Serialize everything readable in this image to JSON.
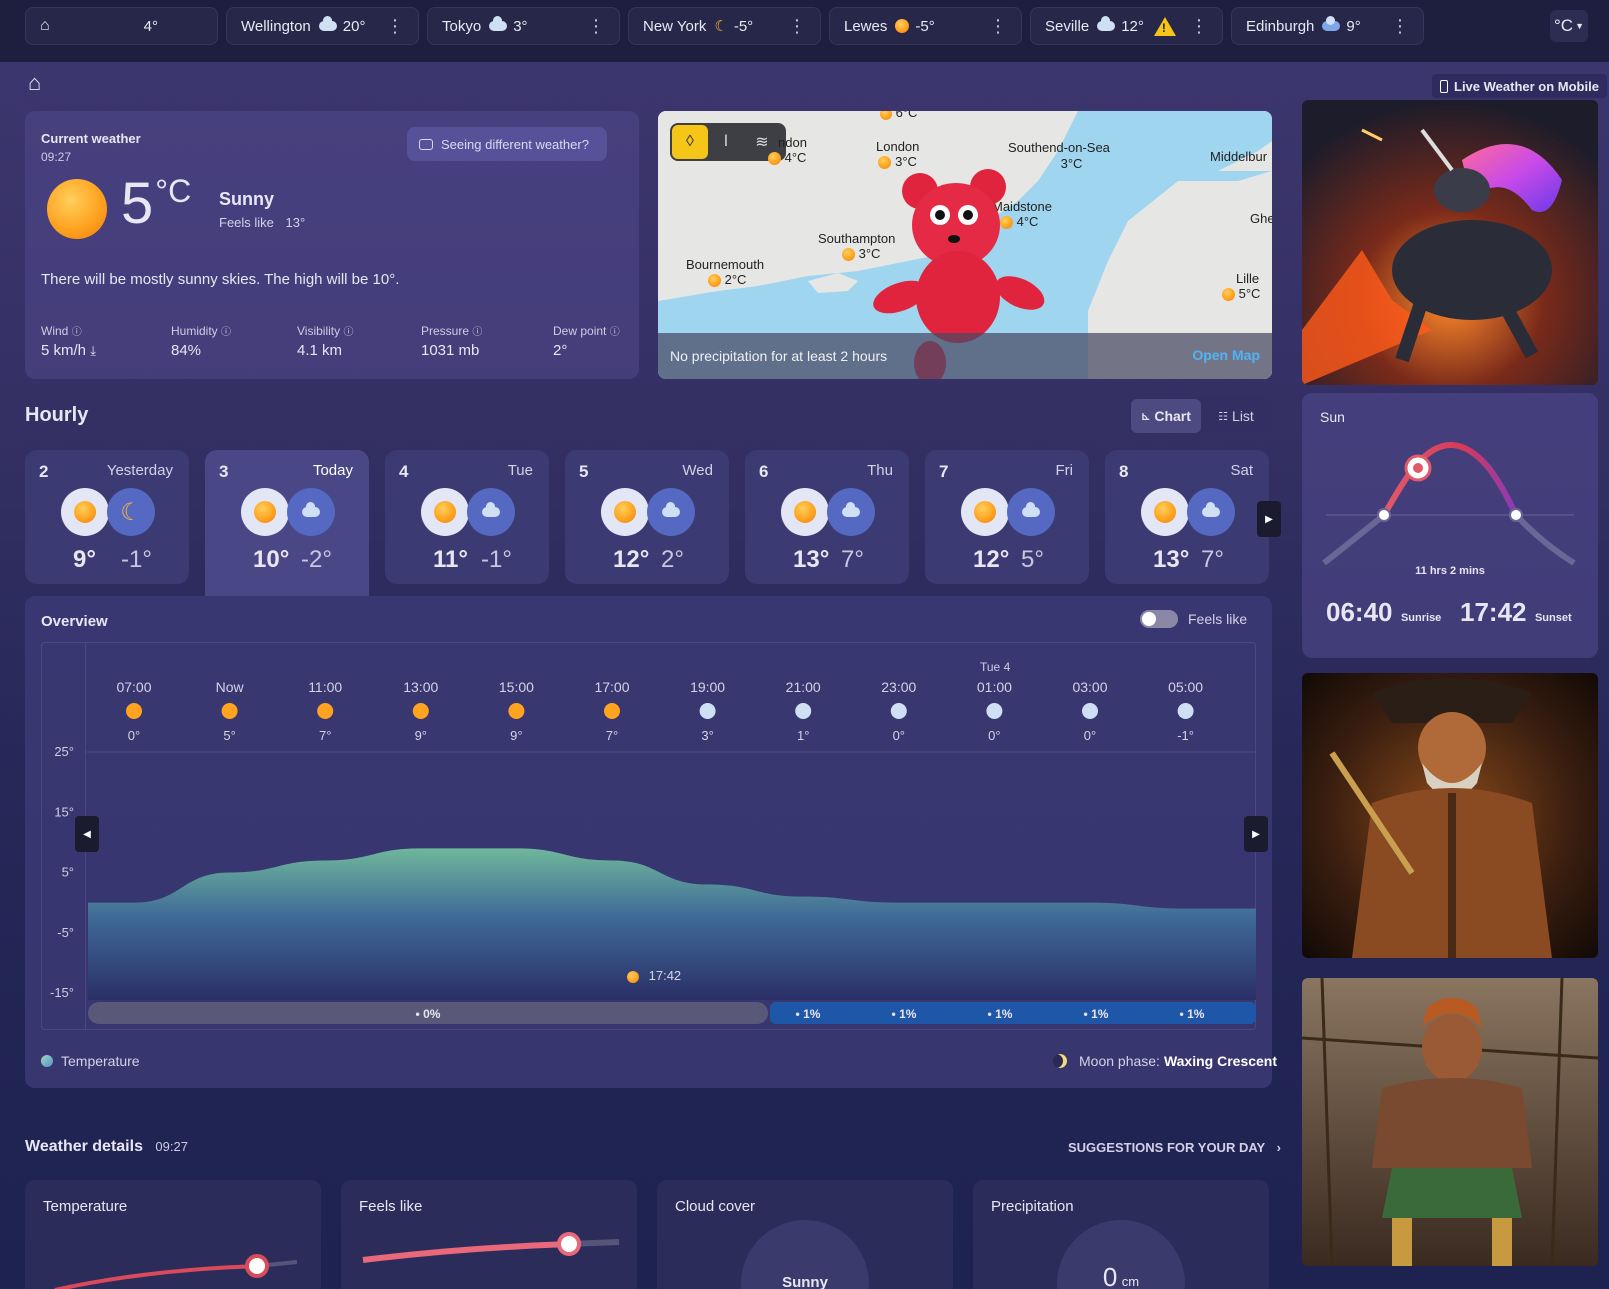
{
  "topbar": {
    "tabs": [
      {
        "name": "",
        "temp": "4°",
        "icon": "sun-icon"
      },
      {
        "name": "Wellington",
        "temp": "20°",
        "icon": "cloud-icon"
      },
      {
        "name": "Tokyo",
        "temp": "3°",
        "icon": "cloud-icon"
      },
      {
        "name": "New York",
        "temp": "-5°",
        "icon": "moon-icon"
      },
      {
        "name": "Lewes",
        "temp": "-5°",
        "icon": "partly-cloudy-icon"
      },
      {
        "name": "Seville",
        "temp": "12°",
        "icon": "cloud-icon",
        "warning": "!"
      },
      {
        "name": "Edinburgh",
        "temp": "9°",
        "icon": "rain-cloud-icon"
      }
    ],
    "unit": "°C"
  },
  "mobile_link": "Live Weather on Mobile",
  "current": {
    "title": "Current weather",
    "time": "09:27",
    "feedback": "Seeing different weather?",
    "temp": "5",
    "unit": "°C",
    "condition": "Sunny",
    "feels_label": "Feels like",
    "feels_value": "13°",
    "summary": "There will be mostly sunny skies. The high will be 10°.",
    "stats": [
      {
        "label": "Wind",
        "value": "5 km/h"
      },
      {
        "label": "Humidity",
        "value": "84%"
      },
      {
        "label": "Visibility",
        "value": "4.1 km"
      },
      {
        "label": "Pressure",
        "value": "1031 mb"
      },
      {
        "label": "Dew point",
        "value": "2°"
      }
    ]
  },
  "map": {
    "places": [
      {
        "name": "",
        "temp": "6°C"
      },
      {
        "name": "ndon",
        "temp": "4°C"
      },
      {
        "name": "London",
        "temp": "3°C"
      },
      {
        "name": "Southend-on-Sea",
        "temp": "3°C"
      },
      {
        "name": "Middelbur",
        "temp": ""
      },
      {
        "name": "Maidstone",
        "temp": "4°C"
      },
      {
        "name": "Ghe",
        "temp": ""
      },
      {
        "name": "Southampton",
        "temp": "3°C"
      },
      {
        "name": "Bournemouth",
        "temp": "2°C"
      },
      {
        "name": "Lille",
        "temp": "5°C"
      }
    ],
    "status": "No precipitation for at least 2 hours",
    "open": "Open Map"
  },
  "hourly": {
    "title": "Hourly",
    "view_chart": "Chart",
    "view_list": "List",
    "days": [
      {
        "num": "2",
        "name": "Yesterday",
        "hi": "9°",
        "lo": "-1°"
      },
      {
        "num": "3",
        "name": "Today",
        "hi": "10°",
        "lo": "-2°"
      },
      {
        "num": "4",
        "name": "Tue",
        "hi": "11°",
        "lo": "-1°"
      },
      {
        "num": "5",
        "name": "Wed",
        "hi": "12°",
        "lo": "2°"
      },
      {
        "num": "6",
        "name": "Thu",
        "hi": "13°",
        "lo": "7°"
      },
      {
        "num": "7",
        "name": "Fri",
        "hi": "12°",
        "lo": "5°"
      },
      {
        "num": "8",
        "name": "Sat",
        "hi": "13°",
        "lo": "7°"
      }
    ]
  },
  "overview": {
    "title": "Overview",
    "feels_toggle": "Feels like",
    "day_marker": "Tue 4",
    "sunset_marker": "17:42",
    "legend": "Temperature",
    "moon_label": "Moon phase:",
    "moon_value": "Waxing Crescent"
  },
  "chart_data": {
    "type": "area",
    "x": [
      "07:00",
      "Now",
      "11:00",
      "13:00",
      "15:00",
      "17:00",
      "19:00",
      "21:00",
      "23:00",
      "01:00",
      "03:00",
      "05:00"
    ],
    "series": [
      {
        "name": "Temperature",
        "values": [
          0,
          5,
          7,
          9,
          9,
          7,
          3,
          1,
          0,
          0,
          0,
          -1
        ]
      }
    ],
    "yticks": [
      "25°",
      "15°",
      "5°",
      "-5°",
      "-15°"
    ],
    "ylim": [
      -15,
      25
    ],
    "precip": [
      {
        "label": "0%"
      },
      {
        "label": "1%"
      },
      {
        "label": "1%"
      },
      {
        "label": "1%"
      },
      {
        "label": "1%"
      },
      {
        "label": "1%"
      }
    ]
  },
  "sun": {
    "title": "Sun",
    "duration": "11 hrs 2 mins",
    "sunrise": "06:40",
    "sunrise_label": "Sunrise",
    "sunset": "17:42",
    "sunset_label": "Sunset"
  },
  "details": {
    "title": "Weather details",
    "time": "09:27",
    "suggestions": "SUGGESTIONS FOR YOUR DAY",
    "cards": [
      {
        "title": "Temperature"
      },
      {
        "title": "Feels like"
      },
      {
        "title": "Cloud cover",
        "value": "Sunny"
      },
      {
        "title": "Precipitation",
        "value": "0",
        "unit": "cm"
      }
    ]
  },
  "colors": {
    "accent_orange": "#ffa321",
    "temp_area_top": "#6fb79b",
    "precip_blue": "#1f57a8"
  }
}
